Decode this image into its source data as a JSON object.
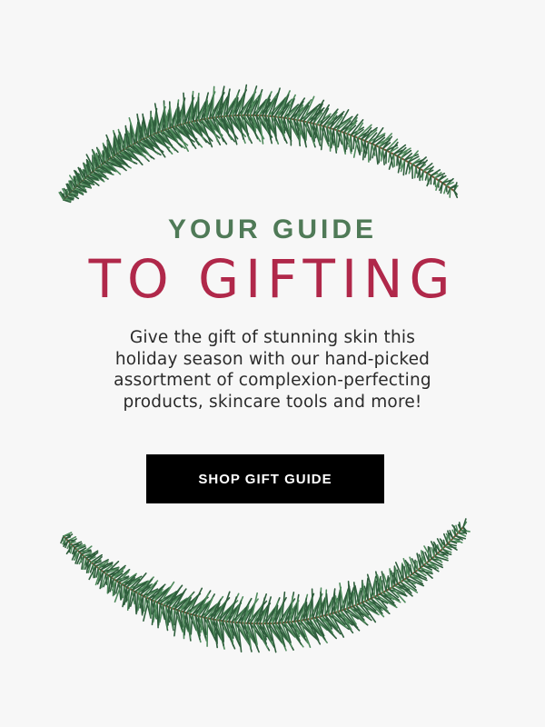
{
  "hero": {
    "kicker": "YOUR GUIDE",
    "headline": "TO GIFTING",
    "body_lines": [
      "Give the gift of stunning skin this",
      "holiday season with our hand-picked",
      "assortment of complexion-perfecting",
      "products, skincare tools and more!"
    ],
    "cta_label": "SHOP GIFT GUIDE"
  },
  "decor": {
    "top_image": "evergreen-garland-icon",
    "bottom_image": "evergreen-garland-icon"
  },
  "colors": {
    "background": "#f7f7f7",
    "kicker": "#4f7a57",
    "headline": "#b0284a",
    "body": "#2a2a2a",
    "cta_bg": "#000000",
    "cta_text": "#ffffff",
    "foliage_dark": "#2e5e3c",
    "foliage_light": "#4f8a5c"
  }
}
